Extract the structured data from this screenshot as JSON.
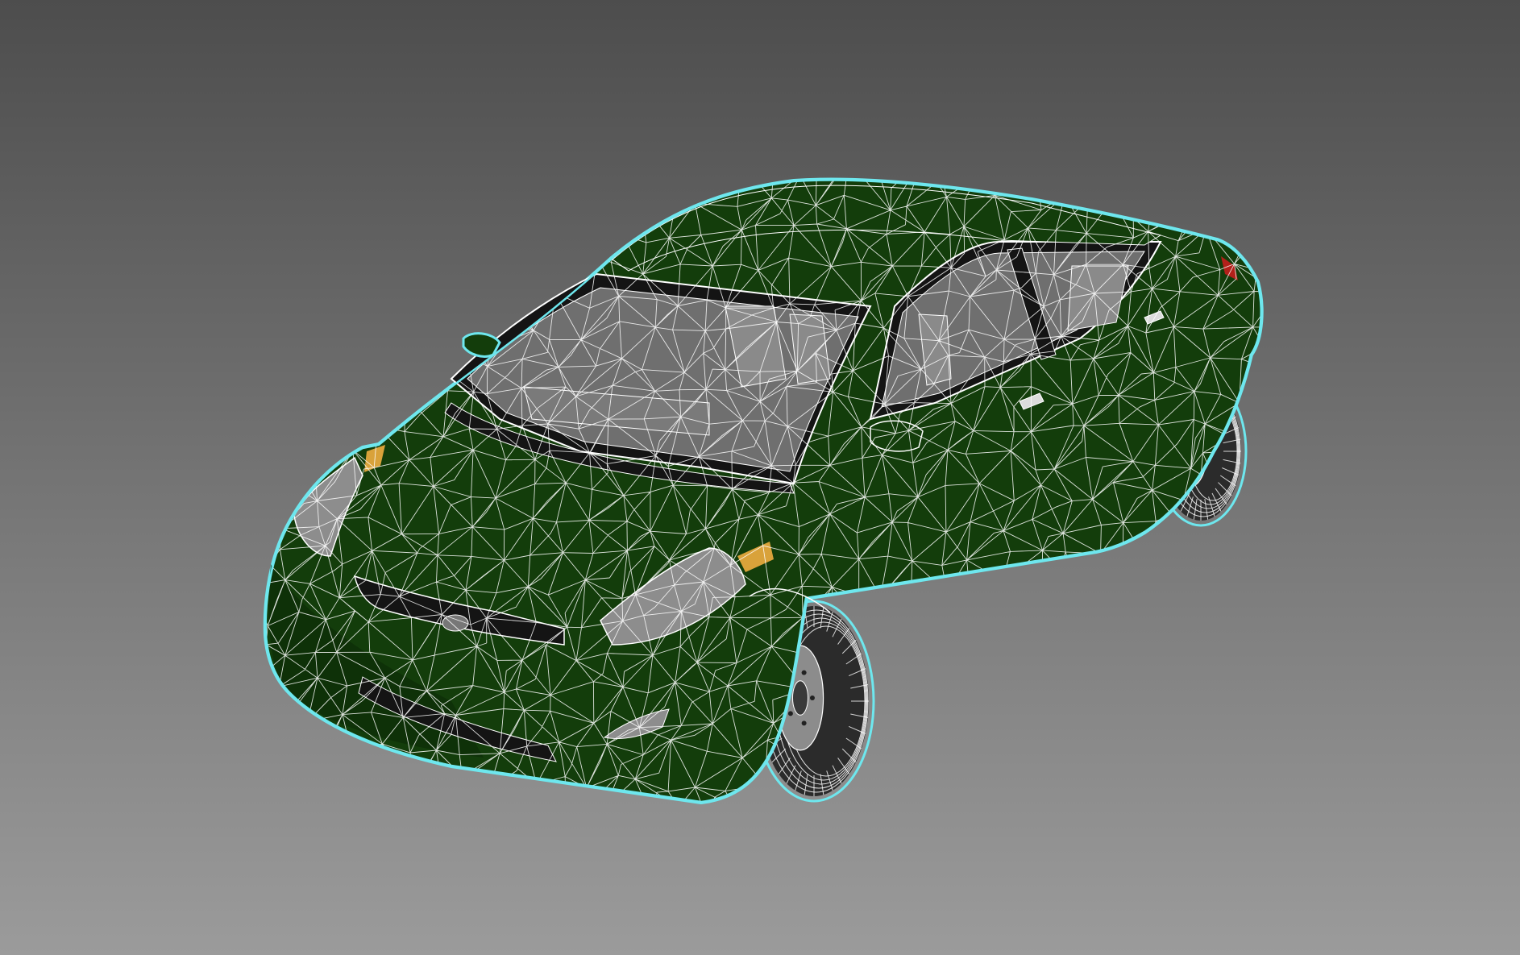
{
  "viewport": {
    "background_top": "#4d4d4d",
    "background_bottom": "#9b9b9b"
  },
  "model": {
    "body_color": "#133d0b",
    "body_shadow_color": "#0c2a07",
    "wire_color": "#ffffff",
    "selection_outline_color": "#6ee7ee",
    "glass_color": "#6f6f6f",
    "interior_color": "#8a8a8a",
    "tire_color": "#2b2b2b",
    "rim_color": "#8c8c8c",
    "trim_color": "#141414",
    "taillight_color": "#b3201a",
    "indicator_color": "#d9a23a",
    "headlight_color": "#8d8d8d"
  }
}
